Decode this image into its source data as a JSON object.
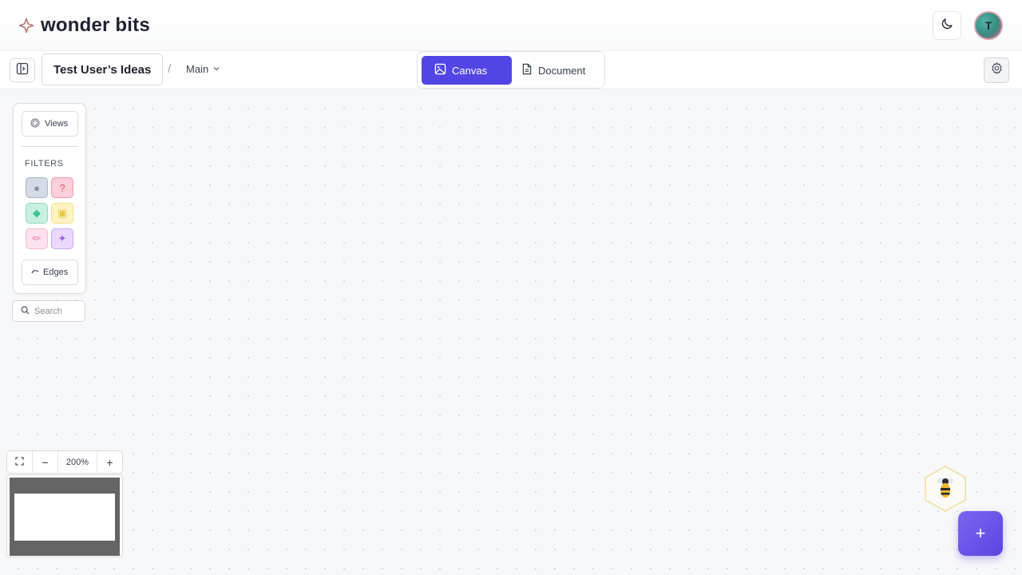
{
  "header": {
    "brand_name": "wonder bits",
    "brand_icon": "sparkle-icon",
    "theme_icon": "moon-icon",
    "avatar_initial": "T"
  },
  "toolbar": {
    "workspace_title": "Test User’s Ideas",
    "separator": "/",
    "branch_label": "Main",
    "tabs": [
      {
        "label": "Canvas",
        "icon": "image-icon",
        "active": true
      },
      {
        "label": "Document",
        "icon": "document-icon",
        "active": false
      }
    ],
    "settings_icon": "gear-icon"
  },
  "panel": {
    "views_label": "Views",
    "filters_heading": "FILTERS",
    "filters": [
      {
        "name": "circle",
        "glyph": "●",
        "bg": "#d5dbe6",
        "border": "#a9b4c6",
        "color": "#8791a3"
      },
      {
        "name": "question",
        "glyph": "?",
        "bg": "#fbd0d8",
        "border": "#f09aab",
        "color": "#e0526d"
      },
      {
        "name": "diamond",
        "glyph": "◆",
        "bg": "#c8f0df",
        "border": "#8edcbd",
        "color": "#3cc493"
      },
      {
        "name": "square",
        "glyph": "▣",
        "bg": "#fdf3c3",
        "border": "#f3e08a",
        "color": "#e9c73d"
      },
      {
        "name": "pencil",
        "glyph": "✏",
        "bg": "#fde2ee",
        "border": "#f7b9d3",
        "color": "#ef7eae"
      },
      {
        "name": "sparkle",
        "glyph": "✦",
        "bg": "#ead9fd",
        "border": "#caa8f5",
        "color": "#9b5de5"
      }
    ],
    "edges_label": "Edges",
    "search_placeholder": "Search"
  },
  "zoom": {
    "level": "200%",
    "minus": "−",
    "plus": "+"
  },
  "fab": {
    "label": "+"
  },
  "colors": {
    "accent": "#5146e5",
    "fab": "#6b57ec"
  }
}
